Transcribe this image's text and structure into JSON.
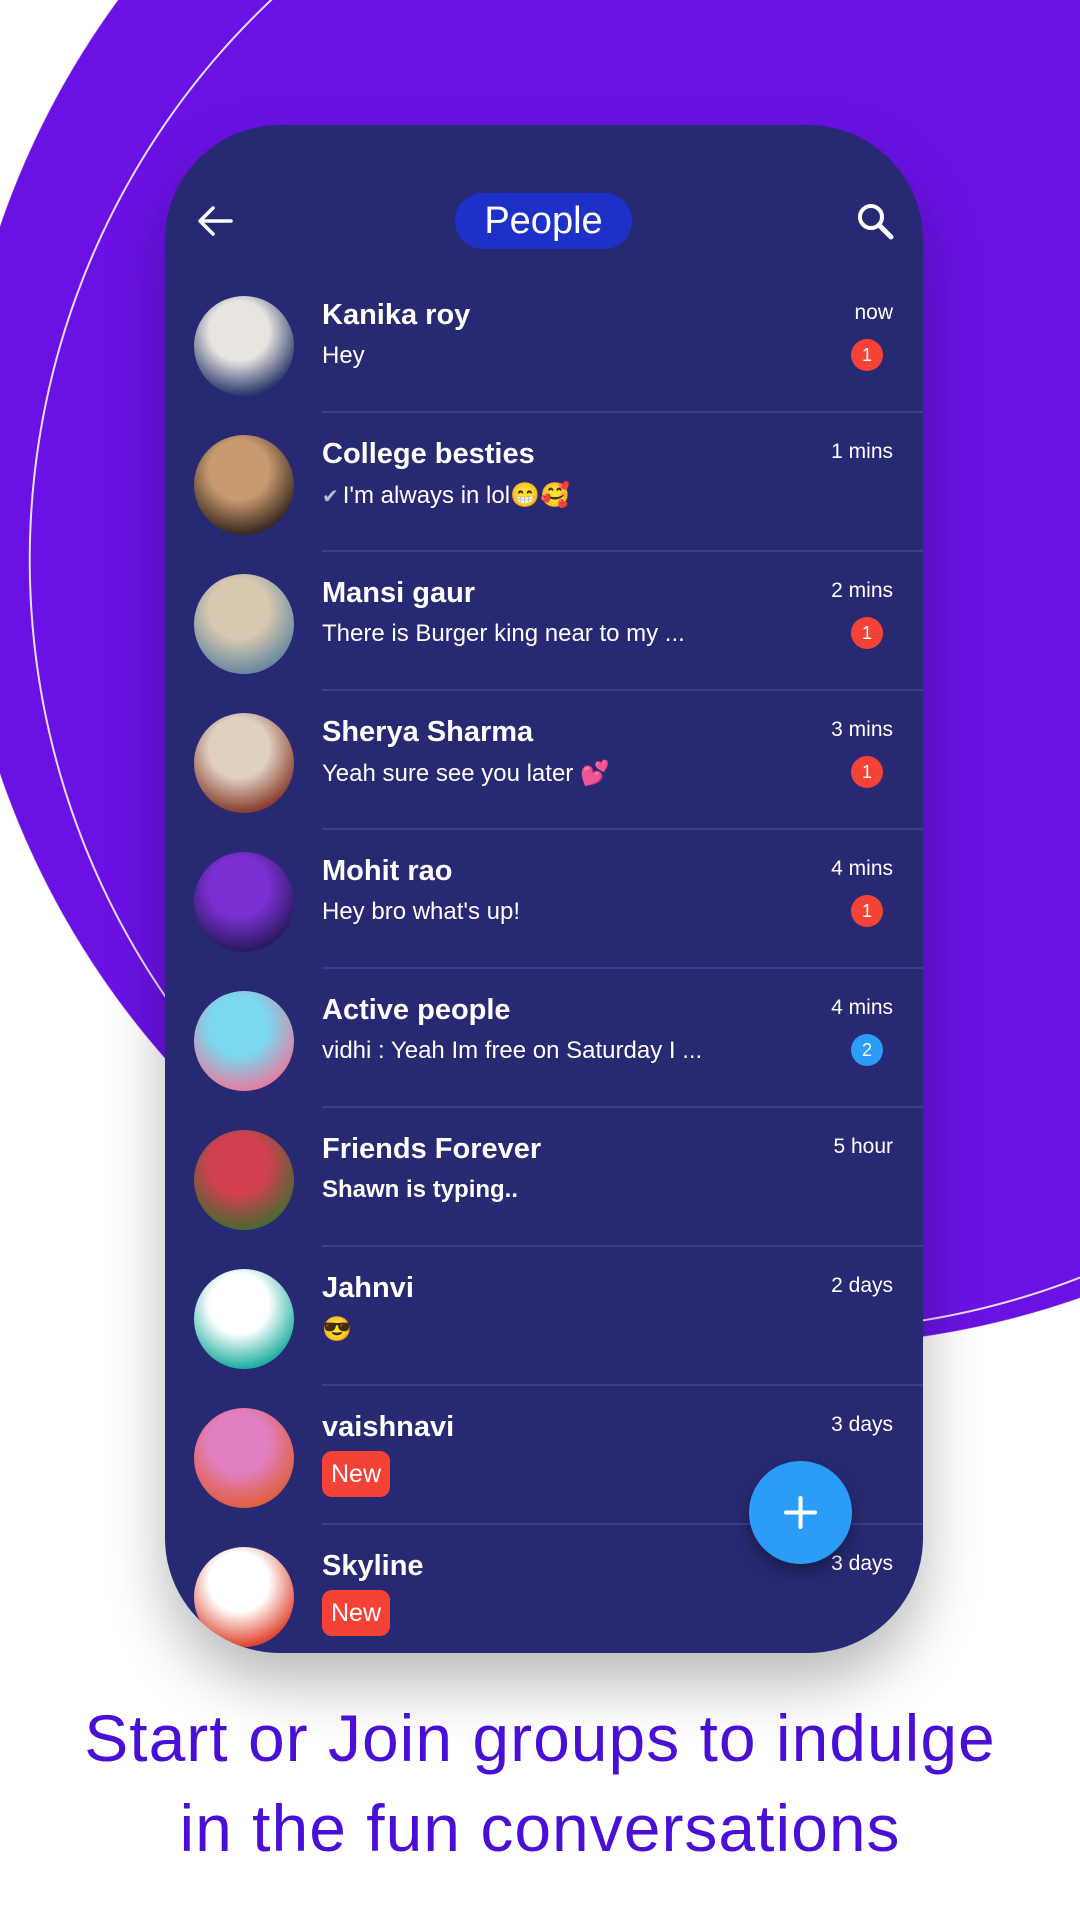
{
  "colors": {
    "background_accent": "#6a12e4",
    "phone_bg": "#272a72",
    "pill": "#1d31c9",
    "badge_red": "#f44336",
    "badge_blue": "#2b9cf7",
    "caption": "#4a0fd6"
  },
  "header": {
    "title": "People",
    "back_icon": "arrow-left-icon",
    "search_icon": "search-icon"
  },
  "chats": [
    {
      "name": "Kanika roy",
      "message": "Hey",
      "time": "now",
      "badge": "1",
      "badge_color": "#f44336",
      "avatar": [
        "#e8e4e0",
        "#2b3a6a"
      ]
    },
    {
      "name": "College besties",
      "message": "I'm always in lol😁🥰",
      "read_check": "✔",
      "time": "1 mins",
      "avatar": [
        "#c89a70",
        "#3a2a20"
      ]
    },
    {
      "name": "Mansi gaur",
      "message": "There is Burger king near to my ...",
      "time": "2 mins",
      "badge": "1",
      "badge_color": "#f44336",
      "avatar": [
        "#d8c8b0",
        "#6a8aa0"
      ]
    },
    {
      "name": "Sherya Sharma",
      "message": "Yeah sure see you later 💕",
      "time": "3 mins",
      "badge": "1",
      "badge_color": "#f44336",
      "avatar": [
        "#e0d0c0",
        "#8a4030"
      ]
    },
    {
      "name": "Mohit rao",
      "message": "Hey bro what's up!",
      "time": "4 mins",
      "badge": "1",
      "badge_color": "#f44336",
      "avatar": [
        "#7a30d0",
        "#2a1a60"
      ]
    },
    {
      "name": "Active people",
      "message": "vidhi : Yeah Im free on Saturday I ...",
      "time": "4 mins",
      "badge": "2",
      "badge_color": "#2b9cf7",
      "avatar": [
        "#7ad8f0",
        "#e080a0"
      ]
    },
    {
      "name": "Friends Forever",
      "message": "Shawn is typing..",
      "bold": true,
      "time": "5 hour",
      "avatar": [
        "#d04050",
        "#4a6a30"
      ]
    },
    {
      "name": "Jahnvi",
      "message": "😎",
      "time": "2 days",
      "avatar": [
        "#ffffff",
        "#20b0a0"
      ]
    },
    {
      "name": "vaishnavi",
      "tag": "New",
      "time": "3 days",
      "avatar": [
        "#e080c0",
        "#e06040"
      ]
    },
    {
      "name": "Skyline",
      "tag": "New",
      "time": "3 days",
      "avatar": [
        "#ffffff",
        "#e04830"
      ]
    }
  ],
  "fab": {
    "icon": "plus-icon",
    "label": "+"
  },
  "caption": {
    "line1": "Start or Join groups to indulge",
    "line2": "in the fun conversations"
  }
}
